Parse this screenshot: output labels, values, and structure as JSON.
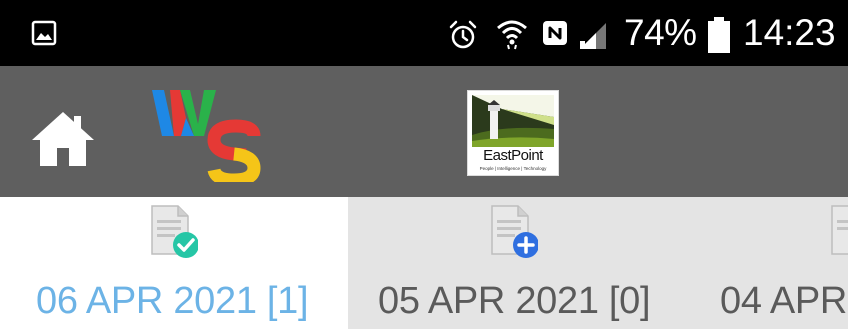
{
  "status_bar": {
    "battery_percent": "74%",
    "time": "14:23",
    "icons": [
      "image-notification-icon",
      "alarm-icon",
      "wifi-icon",
      "nfc-icon",
      "signal-icon",
      "battery-icon"
    ]
  },
  "app_bar": {
    "home_icon": "home-icon",
    "ws_logo": {
      "letter_w": "W",
      "letter_s": "S",
      "colors": [
        "#1e88e5",
        "#2ab24a",
        "#e53935",
        "#f5c518"
      ]
    },
    "partner_logo": {
      "name": "EastPoint",
      "tagline": "People | Intelligence | Technology"
    }
  },
  "date_tabs": [
    {
      "label": "06 APR 2021 [1]",
      "status_icon": "check-icon",
      "active": true
    },
    {
      "label": "05 APR 2021 [0]",
      "status_icon": "plus-icon",
      "active": false
    },
    {
      "label": "04 APR",
      "status_icon": "document-icon",
      "active": false
    }
  ],
  "colors": {
    "status_bar_bg": "#000000",
    "app_bar_bg": "#5f5f5f",
    "tab_active_bg": "#ffffff",
    "tab_inactive_bg": "#e4e4e4",
    "active_text": "#6cb3e6",
    "inactive_text": "#5a5a5a",
    "check_badge": "#26c6a6",
    "plus_badge": "#2f6fe0"
  }
}
